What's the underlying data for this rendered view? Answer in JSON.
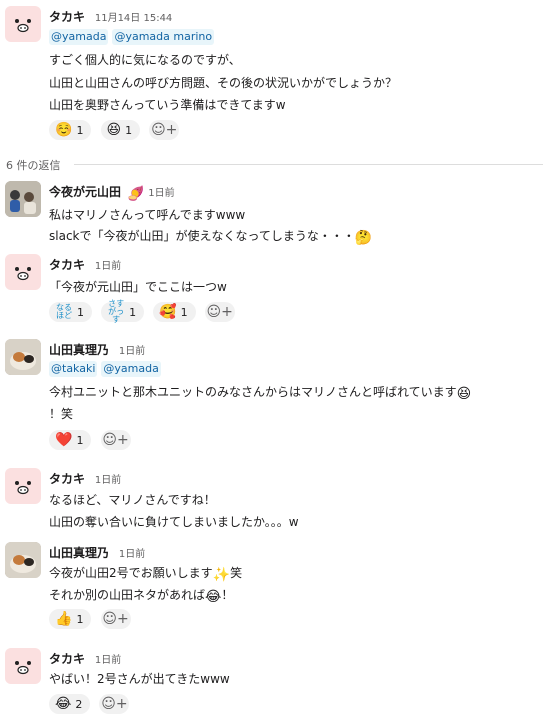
{
  "root": {
    "name": "タカキ",
    "time": "11月14日 15:44",
    "mentions": [
      "@yamada",
      "@yamada marino"
    ],
    "lines": [
      "すごく個人的に気になるのですが、",
      "山田と山田さんの呼び方問題、その後の状況いかがでしょうか？",
      "山田を奥野さんっていう準備はできてますw"
    ],
    "reactions": [
      {
        "emoji": "☺️",
        "count": "1"
      },
      {
        "emoji": "😆",
        "count": "1"
      }
    ]
  },
  "replies_label": "6 件の返信",
  "replies": [
    {
      "name": "今夜が元山田",
      "badge_emoji": "🍠",
      "time": "1日前",
      "lines": [
        "私はマリノさんって呼んでますwww",
        "slackで「今夜が山田」が使えなくなってしまうな・・・"
      ],
      "line_emoji": "🤔"
    },
    {
      "name": "タカキ",
      "time": "1日前",
      "lines": [
        "「今夜が元山田」でここは一つw"
      ],
      "reactions": [
        {
          "emoji_text": "なるほど",
          "count": "1"
        },
        {
          "emoji_text": "さすがっす",
          "count": "1"
        },
        {
          "emoji": "🥰",
          "count": "1"
        }
      ]
    },
    {
      "name": "山田真理乃",
      "time": "1日前",
      "mentions": [
        "@takaki",
        "@yamada"
      ],
      "lines": [
        "今村ユニットと那木ユニットのみなさんからはマリノさんと呼ばれています",
        "！笑"
      ],
      "line_emoji": "😆",
      "reactions": [
        {
          "emoji": "❤️",
          "count": "1"
        }
      ]
    },
    {
      "name": "タカキ",
      "time": "1日前",
      "lines": [
        "なるほど、マリノさんですね！",
        "山田の奪い合いに負けてしまいましたか。。。w"
      ]
    },
    {
      "name": "山田真理乃",
      "time": "1日前",
      "lines": [
        "今夜が山田2号でお願いします",
        "笑",
        "それか別の山田ネタがあれば",
        "！"
      ],
      "emojis": [
        "✨",
        "😂"
      ],
      "reactions": [
        {
          "emoji": "👍",
          "count": "1"
        }
      ]
    },
    {
      "name": "タカキ",
      "time": "1日前",
      "lines": [
        "やばい！2号さんが出てきたwww"
      ],
      "reactions": [
        {
          "emoji": "😂",
          "count": "2"
        }
      ]
    }
  ],
  "icons": {
    "add_reaction": "add-reaction-icon",
    "pig_avatar": "pig-icon"
  }
}
